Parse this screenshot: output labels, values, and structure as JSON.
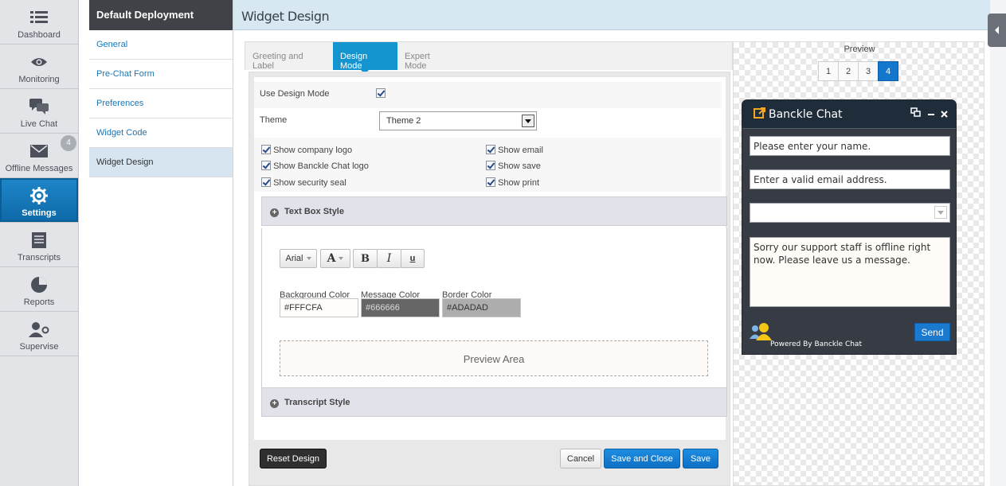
{
  "nav": {
    "items": [
      {
        "label": "Dashboard",
        "icon": "dashboard-icon"
      },
      {
        "label": "Monitoring",
        "icon": "eye-icon"
      },
      {
        "label": "Live Chat",
        "icon": "chat-bubbles-icon"
      },
      {
        "label": "Offline Messages",
        "icon": "envelope-icon"
      },
      {
        "label": "Settings",
        "icon": "gear-icon"
      },
      {
        "label": "Transcripts",
        "icon": "document-icon"
      },
      {
        "label": "Reports",
        "icon": "pie-chart-icon"
      },
      {
        "label": "Supervise",
        "icon": "user-gear-icon"
      }
    ],
    "offline_badge": "4",
    "active": "Settings"
  },
  "subnav": {
    "title": "Default Deployment",
    "items": [
      "General",
      "Pre-Chat Form",
      "Preferences",
      "Widget Code",
      "Widget Design"
    ],
    "active": "Widget Design"
  },
  "header": {
    "title": "Widget Design"
  },
  "tabs": {
    "items": [
      "Greeting and Label",
      "Design Mode",
      "Expert Mode"
    ],
    "active": "Design Mode"
  },
  "form": {
    "use_design_mode_label": "Use Design Mode",
    "theme_label": "Theme",
    "theme_value": "Theme 2",
    "checkboxes_left": [
      "Show company logo",
      "Show Banckle Chat logo",
      "Show security seal"
    ],
    "checkboxes_right": [
      "Show email",
      "Show save",
      "Show print"
    ]
  },
  "text_box_style": {
    "heading": "Text Box Style",
    "font_value": "Arial",
    "bold": "B",
    "italic": "I",
    "underline": "u",
    "font_color_glyph": "A",
    "bg_color_label": "Background Color",
    "bg_color_value": "#FFFCFA",
    "msg_color_label": "Message Color",
    "msg_color_value": "#666666",
    "border_color_label": "Border Color",
    "border_color_value": "#ADADAD",
    "preview_area": "Preview Area"
  },
  "transcript_style": {
    "heading": "Transcript Style"
  },
  "buttons": {
    "reset": "Reset Design",
    "cancel": "Cancel",
    "save_close": "Save and Close",
    "save": "Save"
  },
  "preview": {
    "label": "Preview",
    "pages": [
      "1",
      "2",
      "3",
      "4"
    ],
    "active_page": "4"
  },
  "chat": {
    "title": "Banckle Chat",
    "name_value": "Please enter your name.",
    "email_value": "Enter a valid email address.",
    "select_value": "",
    "message_value": "Sorry our support staff is offline right now. Please leave us a message.",
    "send": "Send",
    "powered": "Powered By Banckle Chat"
  },
  "colors": {
    "accent": "#1595cf",
    "primary_button": "#1377cd",
    "chat_header": "#1f2c3a",
    "chat_body": "#373c44"
  }
}
